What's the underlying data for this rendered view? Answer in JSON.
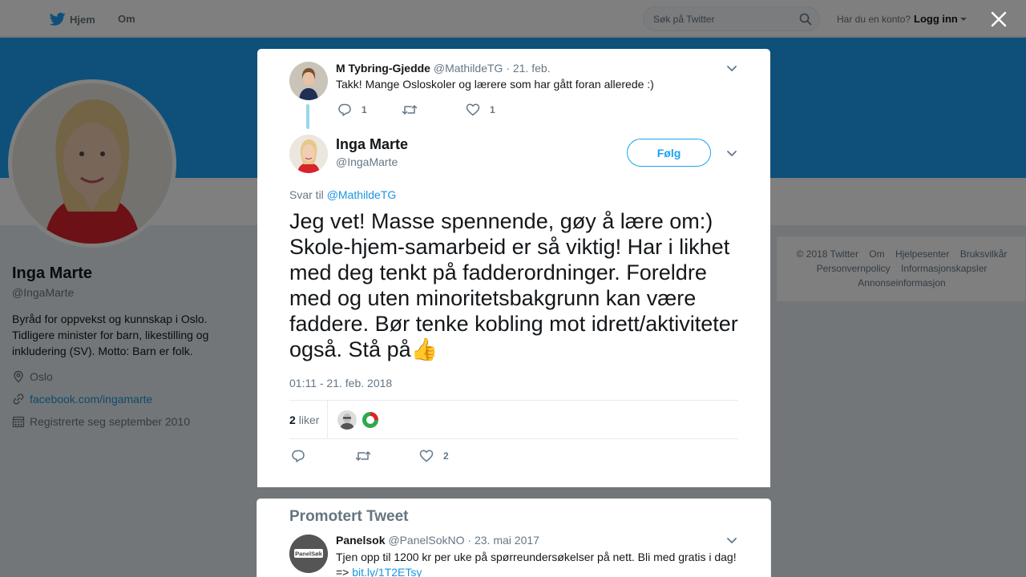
{
  "nav": {
    "home_label": "Hjem",
    "about_label": "Om",
    "search_placeholder": "Søk på Twitter",
    "account_prompt": "Har du en konto?",
    "login_label": "Logg inn"
  },
  "profile": {
    "name": "Inga Marte",
    "handle": "@IngaMarte",
    "bio": "Byråd for oppvekst og kunnskap i Oslo. Tidligere minister for barn, likestilling og inkludering (SV). Motto: Barn er folk.",
    "location": "Oslo",
    "url": "facebook.com/ingamarte",
    "joined": "Registrerte seg september 2010"
  },
  "footer": {
    "links": [
      "© 2018 Twitter",
      "Om",
      "Hjelpesenter",
      "Bruksvilkår",
      "Personvernpolicy",
      "Informasjonskapsler",
      "Annonseinformasjon"
    ]
  },
  "parent_tweet": {
    "name": "M Tybring-Gjedde",
    "handle": "@MathildeTG",
    "separator": "·",
    "date": "21. feb.",
    "text": "Takk! Mange Osloskoler og lærere som har gått foran allerede :)",
    "replies": "1",
    "likes": "1"
  },
  "main_tweet": {
    "name": "Inga Marte",
    "handle": "@IngaMarte",
    "follow_label": "Følg",
    "reply_prefix": "Svar til",
    "reply_to": "@MathildeTG",
    "text": "Jeg vet! Masse spennende, gøy å lære om:) Skole-hjem-samarbeid er så viktig! Har i likhet med deg tenkt på fadderordninger. Foreldre med og uten minoritetsbakgrunn kan være faddere. Bør tenke kobling mot idrett/aktiviteter også. Stå på👍",
    "timestamp": "01:11 - 21. feb. 2018",
    "likes_count": "2",
    "likes_label": "liker",
    "action_likes": "2"
  },
  "promoted": {
    "heading": "Promotert Tweet",
    "name": "Panelsok",
    "handle": "@PanelSokNO",
    "separator": "·",
    "date": "23. mai 2017",
    "text": "Tjen opp til 1200 kr per uke på spørreundersøkelser på nett. Bli med gratis i dag! =>",
    "link": "bit.ly/1T2ETsy",
    "logo_text": "PanelSøk"
  },
  "colors": {
    "accent": "#1da1f2",
    "link": "#1b95e0",
    "muted": "#657786",
    "thread_line": "#9ad7ec"
  }
}
